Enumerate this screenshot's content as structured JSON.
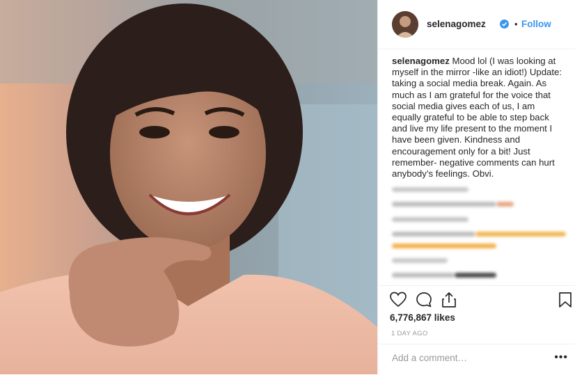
{
  "post": {
    "username": "selenagomez",
    "follow_label": "Follow",
    "separator": "•",
    "caption_user": "selenagomez",
    "caption_text": " Mood lol (I was looking at myself in the mirror -like an idiot!) Update: taking a social media break. Again. As much as I am grateful for the voice that social media gives each of us, I am equally grateful to be able to step back and live my life present to the moment I have been given. Kindness and encouragement only for a bit! Just remember- negative comments can hurt anybody’s feelings. Obvi.",
    "likes": "6,776,867 likes",
    "time_ago": "1 DAY AGO",
    "comment_placeholder": "Add a comment…",
    "more_label": "•••"
  },
  "icons": {
    "verified": "verified-badge-icon",
    "like": "heart-icon",
    "comment": "comment-bubble-icon",
    "share": "share-icon",
    "save": "bookmark-icon"
  },
  "colors": {
    "follow": "#3897f0",
    "verified": "#3897f0",
    "text": "#262626",
    "muted": "#999999",
    "border": "#efefef"
  }
}
